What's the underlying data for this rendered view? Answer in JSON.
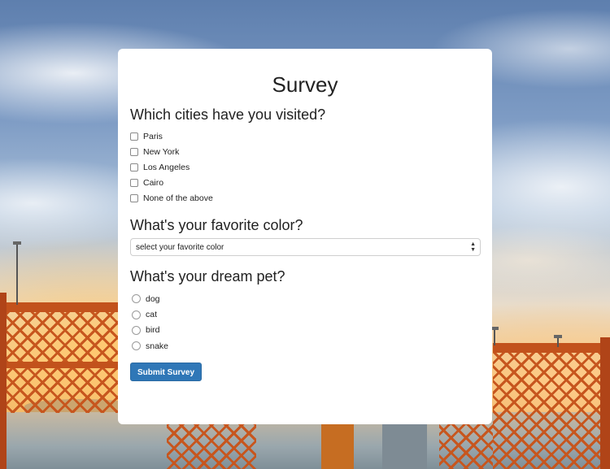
{
  "survey": {
    "title": "Survey",
    "q_cities": {
      "question": "Which cities have you visited?",
      "options": [
        "Paris",
        "New York",
        "Los Angeles",
        "Cairo",
        "None of the above"
      ]
    },
    "q_color": {
      "question": "What's your favorite color?",
      "selected": "select your favorite color"
    },
    "q_pet": {
      "question": "What's your dream pet?",
      "options": [
        "dog",
        "cat",
        "bird",
        "snake"
      ]
    },
    "submit_label": "Submit Survey"
  },
  "icons": {
    "select_arrows": "chevron-up-down-icon"
  },
  "colors": {
    "submit_button": "#2f77b7",
    "card_background": "#ffffff"
  }
}
